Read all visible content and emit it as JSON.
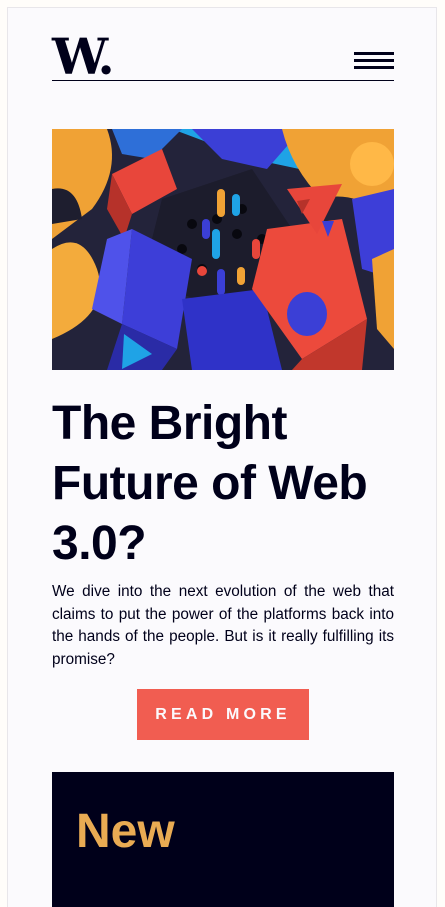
{
  "header": {
    "logo_text": "W.",
    "menu_icon": "hamburger-menu-icon"
  },
  "hero": {
    "image_subject": "abstract colorful 3D geometric blocks and pegs"
  },
  "article": {
    "title": "The Bright Future of Web 3.0?",
    "description": "We dive into the next evolution of the web that claims to put the power of the platforms back into the hands of the people. But is it really fulfilling its promise?",
    "cta_label": "READ MORE"
  },
  "new_section": {
    "heading": "New"
  },
  "colors": {
    "background": "#fbfafd",
    "dark": "#00001a",
    "accent_red": "#f15d51",
    "accent_gold": "#e9ab53"
  }
}
